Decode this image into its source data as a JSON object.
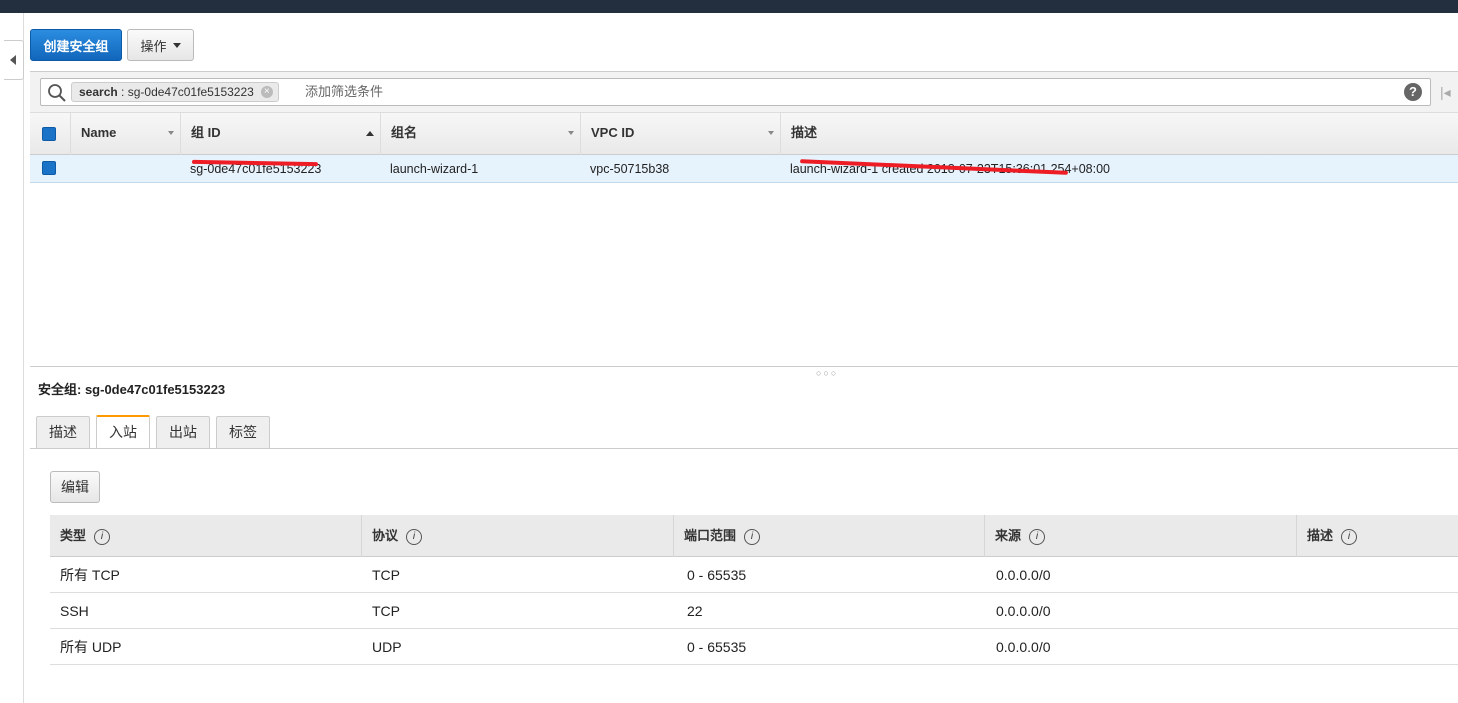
{
  "toolbar": {
    "create_label": "创建安全组",
    "actions_label": "操作"
  },
  "search": {
    "token_key": "search",
    "token_value": "sg-0de47c01fe5153223",
    "placeholder": "添加筛选条件"
  },
  "grid": {
    "columns": [
      {
        "label": "Name",
        "sort": "none"
      },
      {
        "label": "组 ID",
        "sort": "ascending"
      },
      {
        "label": "组名",
        "sort": "none"
      },
      {
        "label": "VPC ID",
        "sort": "none"
      },
      {
        "label": "描述",
        "sort": "none"
      }
    ],
    "rows": [
      {
        "name": "",
        "group_id": "sg-0de47c01fe5153223",
        "group_name": "launch-wizard-1",
        "vpc_id": "vpc-50715b38",
        "description": "launch-wizard-1 created 2018-07-23T15:36:01.254+08:00",
        "selected": true
      }
    ]
  },
  "detail": {
    "title": "安全组: sg-0de47c01fe5153223",
    "tabs": [
      {
        "label": "描述",
        "active": false
      },
      {
        "label": "入站",
        "active": true
      },
      {
        "label": "出站",
        "active": false
      },
      {
        "label": "标签",
        "active": false
      }
    ],
    "edit_label": "编辑",
    "rule_columns": [
      "类型",
      "协议",
      "端口范围",
      "来源",
      "描述"
    ],
    "rules": [
      {
        "type": "所有 TCP",
        "protocol": "TCP",
        "port_range": "0 - 65535",
        "source": "0.0.0.0/0",
        "description": ""
      },
      {
        "type": "SSH",
        "protocol": "TCP",
        "port_range": "22",
        "source": "0.0.0.0/0",
        "description": ""
      },
      {
        "type": "所有 UDP",
        "protocol": "UDP",
        "port_range": "0 - 65535",
        "source": "0.0.0.0/0",
        "description": ""
      }
    ]
  },
  "colors": {
    "primary": "#1166bb",
    "selected_row": "#e6f2fc",
    "tab_accent": "#ff9900",
    "redaction": "#ee1c25",
    "header_bar": "#232f3e"
  }
}
